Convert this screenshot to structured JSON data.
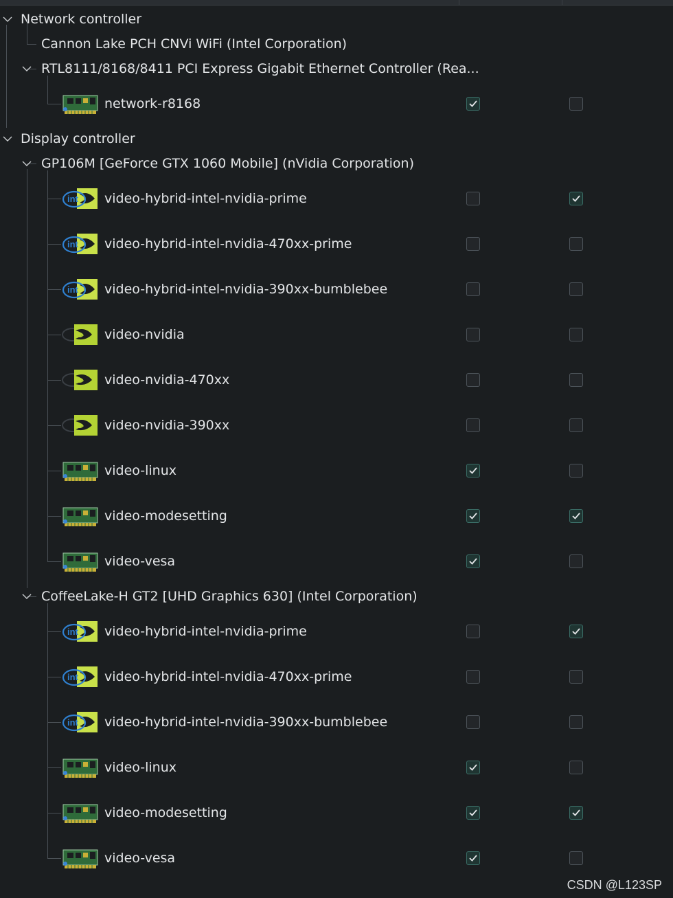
{
  "groups": [
    {
      "title": "Network controller",
      "devices": [
        {
          "title": "Cannon Lake PCH CNVi WiFi (Intel Corporation)",
          "expanded": false,
          "drivers": []
        },
        {
          "title": "RTL8111/8168/8411 PCI Express Gigabit Ethernet Controller (Rea...",
          "expanded": true,
          "drivers": [
            {
              "name": "network-r8168",
              "icon": "pci-card-icon",
              "col1": true,
              "col2": false
            }
          ]
        }
      ]
    },
    {
      "title": "Display controller",
      "devices": [
        {
          "title": "GP106M [GeForce GTX 1060 Mobile] (nVidia Corporation)",
          "expanded": true,
          "drivers": [
            {
              "name": "video-hybrid-intel-nvidia-prime",
              "icon": "intel-nvidia-icon",
              "col1": false,
              "col2": true
            },
            {
              "name": "video-hybrid-intel-nvidia-470xx-prime",
              "icon": "intel-nvidia-icon",
              "col1": false,
              "col2": false
            },
            {
              "name": "video-hybrid-intel-nvidia-390xx-bumblebee",
              "icon": "intel-nvidia-icon",
              "col1": false,
              "col2": false
            },
            {
              "name": "video-nvidia",
              "icon": "nvidia-icon",
              "col1": false,
              "col2": false
            },
            {
              "name": "video-nvidia-470xx",
              "icon": "nvidia-icon",
              "col1": false,
              "col2": false
            },
            {
              "name": "video-nvidia-390xx",
              "icon": "nvidia-icon",
              "col1": false,
              "col2": false
            },
            {
              "name": "video-linux",
              "icon": "pci-card-icon",
              "col1": true,
              "col2": false
            },
            {
              "name": "video-modesetting",
              "icon": "pci-card-icon",
              "col1": true,
              "col2": true
            },
            {
              "name": "video-vesa",
              "icon": "pci-card-icon",
              "col1": true,
              "col2": false
            }
          ]
        },
        {
          "title": "CoffeeLake-H GT2 [UHD Graphics 630] (Intel Corporation)",
          "expanded": true,
          "drivers": [
            {
              "name": "video-hybrid-intel-nvidia-prime",
              "icon": "intel-nvidia-icon",
              "col1": false,
              "col2": true
            },
            {
              "name": "video-hybrid-intel-nvidia-470xx-prime",
              "icon": "intel-nvidia-icon",
              "col1": false,
              "col2": false
            },
            {
              "name": "video-hybrid-intel-nvidia-390xx-bumblebee",
              "icon": "intel-nvidia-icon",
              "col1": false,
              "col2": false
            },
            {
              "name": "video-linux",
              "icon": "pci-card-icon",
              "col1": true,
              "col2": false
            },
            {
              "name": "video-modesetting",
              "icon": "pci-card-icon",
              "col1": true,
              "col2": true
            },
            {
              "name": "video-vesa",
              "icon": "pci-card-icon",
              "col1": true,
              "col2": false
            }
          ]
        }
      ]
    }
  ],
  "watermark": "CSDN @L123SP",
  "colors": {
    "background": "#1b1e20",
    "text": "#e3e5e7",
    "check": "#e3e5e7",
    "checked_bg": "#1f3532"
  }
}
